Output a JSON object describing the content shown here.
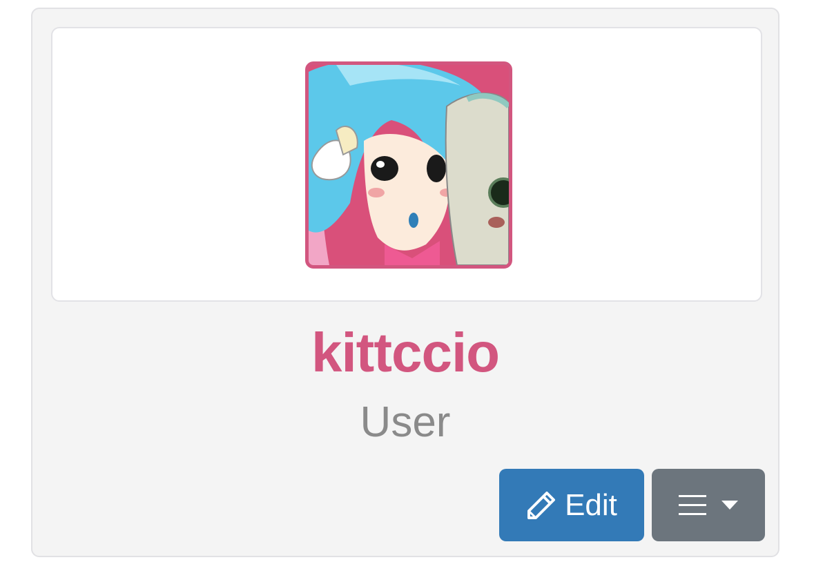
{
  "profile": {
    "username": "kittccio",
    "role": "User",
    "avatar_icon": "anime-avatar-image"
  },
  "actions": {
    "edit_label": "Edit",
    "edit_icon": "pencil-icon",
    "menu_icon": "hamburger-icon",
    "menu_caret_icon": "caret-down-icon"
  },
  "colors": {
    "username": "#d2567f",
    "role": "#8a8a8a",
    "edit_button": "#337ab7",
    "menu_button": "#6c757d",
    "avatar_border": "#d2567f",
    "card_background": "#f4f4f4"
  }
}
